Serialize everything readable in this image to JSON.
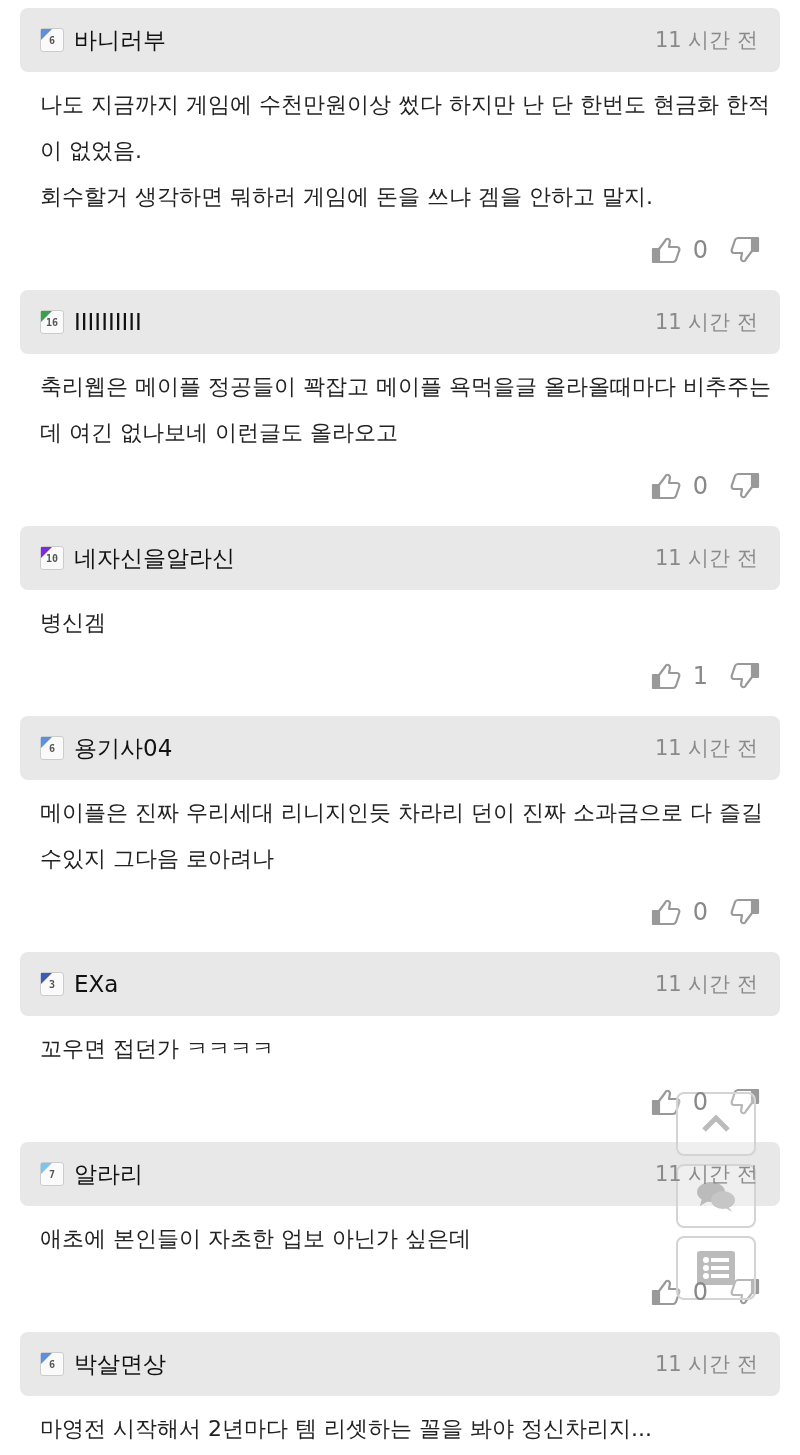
{
  "comments": [
    {
      "level": "6",
      "color": "#5b8fe0",
      "author": "바니러부",
      "time": "11 시간 전",
      "text": "나도 지금까지 게임에 수천만원이상 썼다 하지만 난 단 한번도 현금화 한적이 없었음.\n회수할거 생각하면 뭐하러 게임에 돈을 쓰냐 겜을 안하고 말지.",
      "likes": "0"
    },
    {
      "level": "16",
      "color": "#3aa14a",
      "author": "IIIIIIIIII",
      "time": "11 시간 전",
      "text": "축리웹은 메이플 정공들이 꽉잡고 메이플 욕먹을글 올라올때마다 비추주는데 여긴 없나보네 이런글도 올라오고",
      "likes": "0"
    },
    {
      "level": "10",
      "color": "#7a2be0",
      "author": "네자신을알라신",
      "time": "11 시간 전",
      "text": "병신겜",
      "likes": "1"
    },
    {
      "level": "6",
      "color": "#5b8fe0",
      "author": "용기사04",
      "time": "11 시간 전",
      "text": "메이플은 진짜 우리세대 리니지인듯 차라리 던이 진짜 소과금으로 다 즐길수있지 그다음 로아려나",
      "likes": "0"
    },
    {
      "level": "3",
      "color": "#3d5bb8",
      "author": "EXa",
      "time": "11 시간 전",
      "text": "꼬우면 접던가 ㅋㅋㅋㅋ",
      "likes": "0"
    },
    {
      "level": "7",
      "color": "#7cc4f0",
      "author": "알라리",
      "time": "11 시간 전",
      "text": "애초에 본인들이 자초한 업보 아닌가 싶은데",
      "likes": "0"
    },
    {
      "level": "6",
      "color": "#5b8fe0",
      "author": "박살면상",
      "time": "11 시간 전",
      "text": "마영전 시작해서 2년마다 템 리셋하는 꼴을 봐야 정신차리지..."
    }
  ],
  "floating_buttons": [
    {
      "kind": "top"
    },
    {
      "kind": "comments"
    },
    {
      "kind": "list"
    }
  ]
}
